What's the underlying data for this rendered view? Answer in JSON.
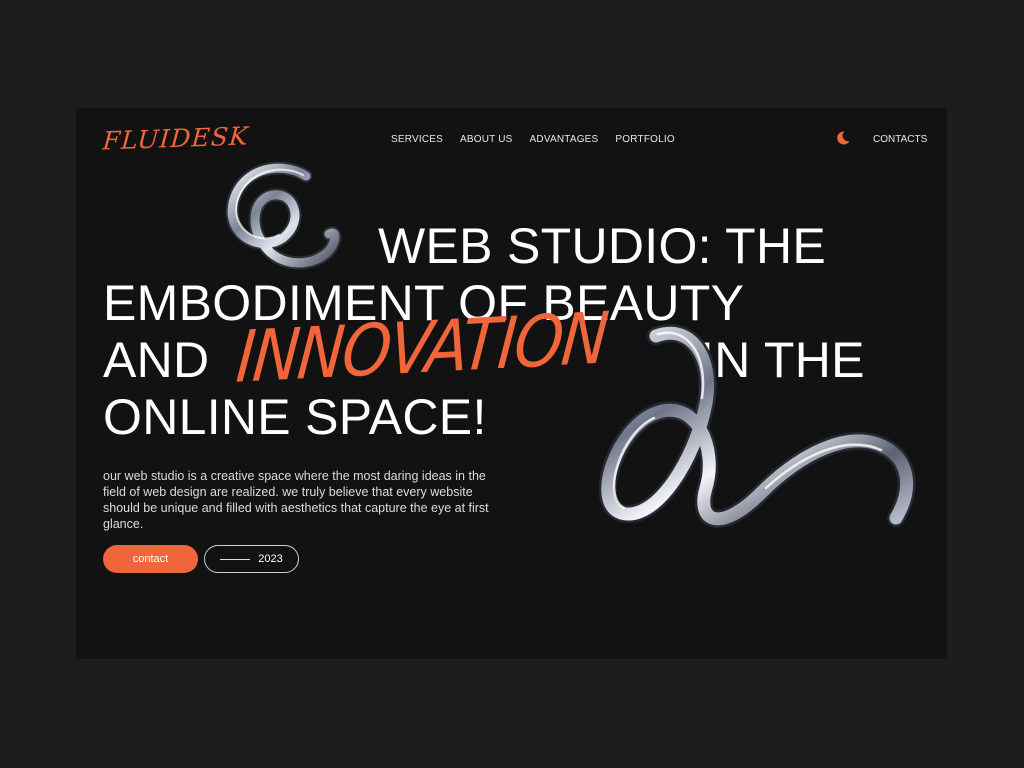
{
  "brand": {
    "logo": "FLUIDESK",
    "accent_color": "#f0653a",
    "background_color": "#121212"
  },
  "nav": {
    "items": [
      {
        "label": "SERVICES"
      },
      {
        "label": "ABOUT US"
      },
      {
        "label": "ADVANTAGES"
      },
      {
        "label": "PORTFOLIO"
      }
    ],
    "theme_toggle_icon": "moon-icon",
    "contacts_label": "CONTACTS"
  },
  "hero": {
    "line1": "WEB STUDIO: THE",
    "line2": "EMBODIMENT OF BEAUTY",
    "line3_start": "AND",
    "accent_word": "INNOVATION",
    "line3_end": "IN THE",
    "line4": "ONLINE SPACE!",
    "description": "our web studio is a creative space where the most daring ideas in the field of web design are realized. we truly believe that every website should be unique and filled with aesthetics that capture the eye at first glance.",
    "decoration_icon": "chrome-coil-icon"
  },
  "actions": {
    "contact_label": "contact",
    "year_label": "2023"
  }
}
